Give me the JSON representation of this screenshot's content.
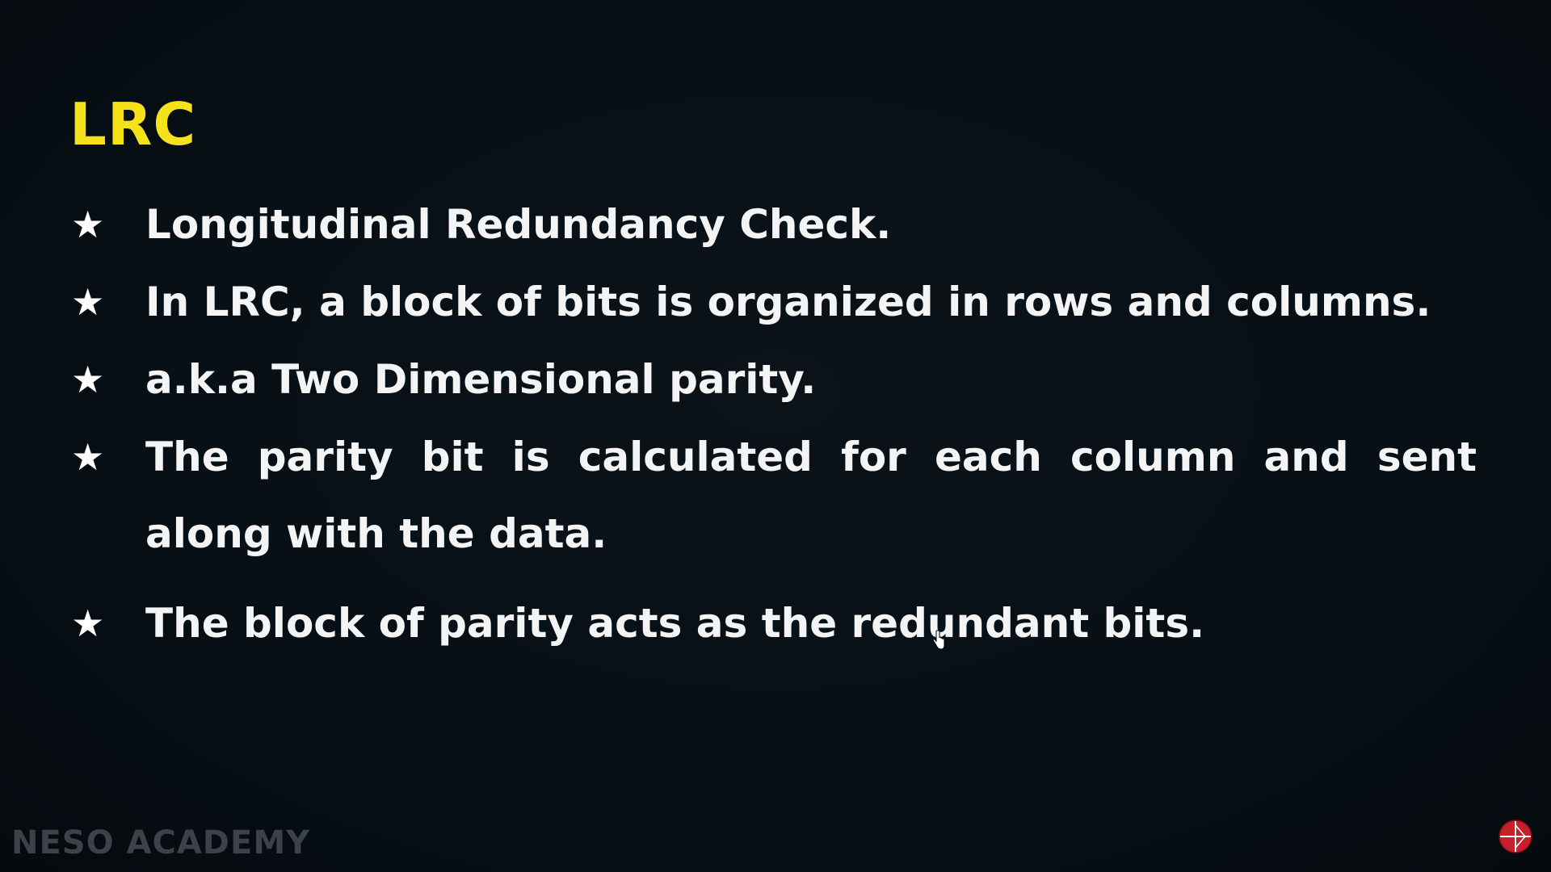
{
  "slide": {
    "title": "LRC",
    "bullets": [
      "Longitudinal Redundancy Check.",
      "In LRC, a block of bits is organized in rows and columns.",
      "a.k.a Two Dimensional parity.",
      "The parity bit is calculated for each column and sent along with the data.",
      "The block of parity acts as the redundant bits."
    ],
    "bullet_symbol": "★"
  },
  "branding": {
    "watermark": "NESO ACADEMY",
    "logo_icon": "neso-logo-icon",
    "logo_color": "#c8202a"
  },
  "colors": {
    "title": "#f6e21b",
    "text": "#f4f4f4",
    "background": "#070d12"
  }
}
